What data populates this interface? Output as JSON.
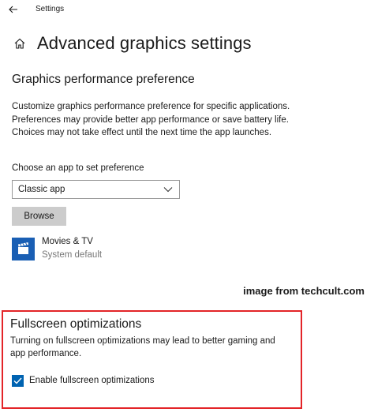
{
  "window": {
    "app_title": "Settings"
  },
  "header": {
    "title": "Advanced graphics settings"
  },
  "graphics": {
    "section_title": "Graphics performance preference",
    "description": "Customize graphics performance preference for specific applications. Preferences may provide better app performance or save battery life. Choices may not take effect until the next time the app launches.",
    "choose_label": "Choose an app to set preference",
    "app_type_selected": "Classic app",
    "browse_label": "Browse"
  },
  "apps": [
    {
      "name": "Movies & TV",
      "setting": "System default",
      "icon": "film-clapper-icon"
    }
  ],
  "watermark": "image from techcult.com",
  "fullscreen": {
    "title": "Fullscreen optimizations",
    "description": "Turning on fullscreen optimizations may lead to better gaming and app performance.",
    "checkbox_label": "Enable fullscreen optimizations",
    "checkbox_checked": true
  },
  "colors": {
    "accent": "#0063b1",
    "app_icon_bg": "#1a5fb4",
    "highlight_border": "#e32428",
    "button_bg": "#cccccc"
  }
}
